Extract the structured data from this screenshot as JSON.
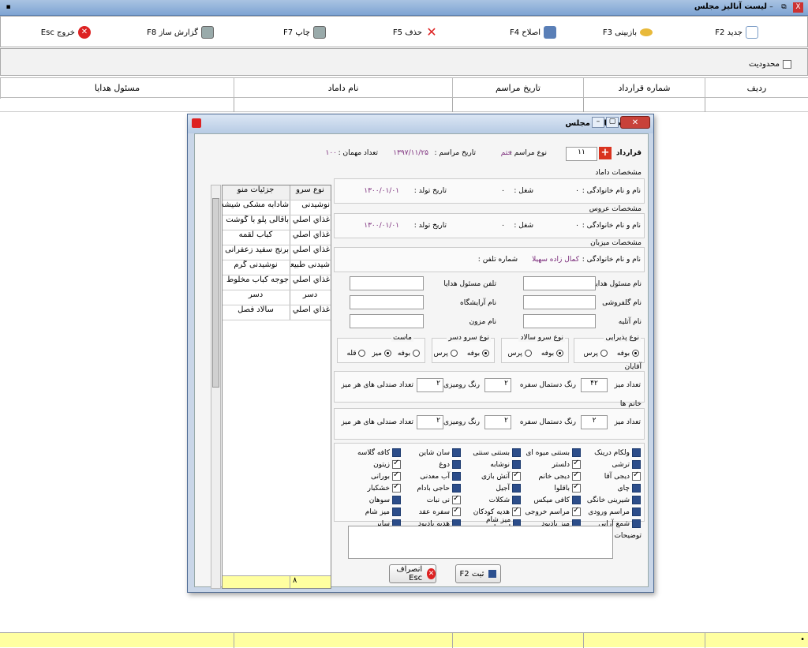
{
  "window": {
    "title": "لیست آنالیز مجلس",
    "close": "X",
    "restore": "⧉",
    "minimize": "–"
  },
  "toolbar": {
    "new": "جدید  F2",
    "view": "بازبینی  F3",
    "edit": "اصلاح  F4",
    "delete": "حذف  F5",
    "print": "چاپ  F7",
    "report": "گزارش ساز  F8",
    "exit": "خروج  Esc"
  },
  "filter": {
    "label": "محدودیت"
  },
  "grid": {
    "headers": [
      "ردیف",
      "شماره قرارداد",
      "تاریخ مراسم",
      "نام داماد",
      "مسئول هدایا"
    ],
    "footer_marker": "•"
  },
  "dialog": {
    "title": "فرم آنالیز مجلس",
    "contract_label": "قرارداد",
    "contract_value": "۱۱",
    "ceremony_type_label": "نوع مراسم :",
    "ceremony_type_value": "ختم",
    "ceremony_date_label": "تاریخ مراسم :",
    "ceremony_date_value": "۱۳۹۷/۱۱/۲۵",
    "guest_count_label": "تعداد مهمان :",
    "guest_count_value": "۱۰۰",
    "groom": {
      "title": "مشخصات داماد",
      "name_label": "نام و نام خانوادگی :",
      "name_value": "۰",
      "job_label": "شغل :",
      "job_value": "۰",
      "birth_label": "تاریخ تولد :",
      "birth_value": "۱۳۰۰/۰۱/۰۱"
    },
    "bride": {
      "title": "مشخصات عروس",
      "name_label": "نام و نام خانوادگی :",
      "name_value": "۰",
      "job_label": "شغل :",
      "job_value": "۰",
      "birth_label": "تاریخ تولد :",
      "birth_value": "۱۳۰۰/۰۱/۰۱"
    },
    "host": {
      "title": "مشخصات میزبان",
      "name_label": "نام و نام خانوادگی :",
      "name_value": "کمال زاده سهیلا",
      "phone_label": "شماره تلفن :",
      "phone_value": ""
    },
    "fields": {
      "gift_manager": "نام مسئول هدایا",
      "gift_manager_phone": "تلفن مسئول هدایا",
      "florist": "نام گلفروشی",
      "salon": "نام آرایشگاه",
      "studio": "نام آتلیه",
      "musician": "نام مزون"
    },
    "groups": {
      "reception": {
        "title": "نوع پذیرایی",
        "options": [
          "بوفه",
          "پرس"
        ]
      },
      "salad": {
        "title": "نوع سرو سالاد",
        "options": [
          "بوفه",
          "پرس"
        ]
      },
      "dessert": {
        "title": "نوع سرو دسر",
        "options": [
          "بوفه",
          "پرس"
        ]
      },
      "yogurt": {
        "title": "ماست",
        "options": [
          "بوفه",
          "میز",
          "قله"
        ]
      }
    },
    "men": {
      "title": "آقایان",
      "table_count_label": "تعداد میز",
      "table_count": "۴۲",
      "napkin_label": "رنگ دستمال سفره",
      "napkin": "۲",
      "cloth_label": "رنگ رومیزی",
      "cloth": "۲",
      "chairs_label": "تعداد صندلی های هر میز",
      "chairs": "۲"
    },
    "women": {
      "title": "خانم ها",
      "table_count_label": "تعداد میز",
      "table_count": "۲",
      "napkin_label": "رنگ دستمال سفره",
      "napkin": "۲",
      "cloth_label": "رنگ رومیزی",
      "cloth": "۲",
      "chairs_label": "تعداد صندلی های هر میز",
      "chairs": "۲"
    },
    "checklist": [
      [
        {
          "label": "ولکام درینک",
          "checked": false
        },
        {
          "label": "ترشی",
          "checked": false
        },
        {
          "label": "دیجی آقا",
          "checked": true
        },
        {
          "label": "چای",
          "checked": false
        },
        {
          "label": "شیرینی خانگی",
          "checked": false
        },
        {
          "label": "مراسم ورودی",
          "checked": false
        },
        {
          "label": "شمع آرایی",
          "checked": false
        }
      ],
      [
        {
          "label": "بستنی میوه ای",
          "checked": false
        },
        {
          "label": "دلستر",
          "checked": true
        },
        {
          "label": "دیجی خانم",
          "checked": true
        },
        {
          "label": "باقلوا",
          "checked": true
        },
        {
          "label": "کافی میکس",
          "checked": false
        },
        {
          "label": "مراسم خروجی",
          "checked": true
        },
        {
          "label": "میز بادبود",
          "checked": false
        }
      ],
      [
        {
          "label": "بستنی سنتی",
          "checked": false
        },
        {
          "label": "نوشابه",
          "checked": false
        },
        {
          "label": "آتش بازی",
          "checked": true
        },
        {
          "label": "آجیل",
          "checked": false
        },
        {
          "label": "شکلات",
          "checked": false
        },
        {
          "label": "هدیه کودکان",
          "checked": true
        },
        {
          "label": "میز شام اختصاصی",
          "checked": false
        }
      ],
      [
        {
          "label": "سان شاین",
          "checked": false
        },
        {
          "label": "دوغ",
          "checked": false
        },
        {
          "label": "آب معدنی",
          "checked": false
        },
        {
          "label": "حاجی بادام",
          "checked": false
        },
        {
          "label": "نی نبات",
          "checked": true
        },
        {
          "label": "سفره عقد",
          "checked": true
        },
        {
          "label": "هدیه بادبود",
          "checked": false
        }
      ],
      [
        {
          "label": "کافه گلاسه",
          "checked": false
        },
        {
          "label": "زیتون",
          "checked": true
        },
        {
          "label": "بورانی",
          "checked": true
        },
        {
          "label": "خشکبار",
          "checked": true
        },
        {
          "label": "سوهان",
          "checked": false
        },
        {
          "label": "میز شام",
          "checked": false
        },
        {
          "label": "سایر",
          "checked": false
        }
      ]
    ],
    "notes_label": "توضیحات",
    "menu": {
      "col1": "نوع سرو",
      "col2": "جزئیات منو",
      "rows": [
        [
          "نوشیدنی",
          "شادابه مشکی شیشه"
        ],
        [
          "غذاي اصلي",
          "باقالی پلو با گوشت"
        ],
        [
          "غذاي اصلي",
          "کباب لقمه"
        ],
        [
          "غذاي اصلي",
          "برنج سفید زعفرانی"
        ],
        [
          "شیدنی طبیعی",
          "نوشیدنی گرم"
        ],
        [
          "غذاي اصلي",
          "جوجه کباب مخلوط"
        ],
        [
          "دسر",
          "دسر"
        ],
        [
          "غذاي اصلي",
          "سالاد فصل"
        ]
      ],
      "count": "۸"
    },
    "save_label": "ثبت  F2",
    "cancel_label": "انصراف  Esc"
  }
}
